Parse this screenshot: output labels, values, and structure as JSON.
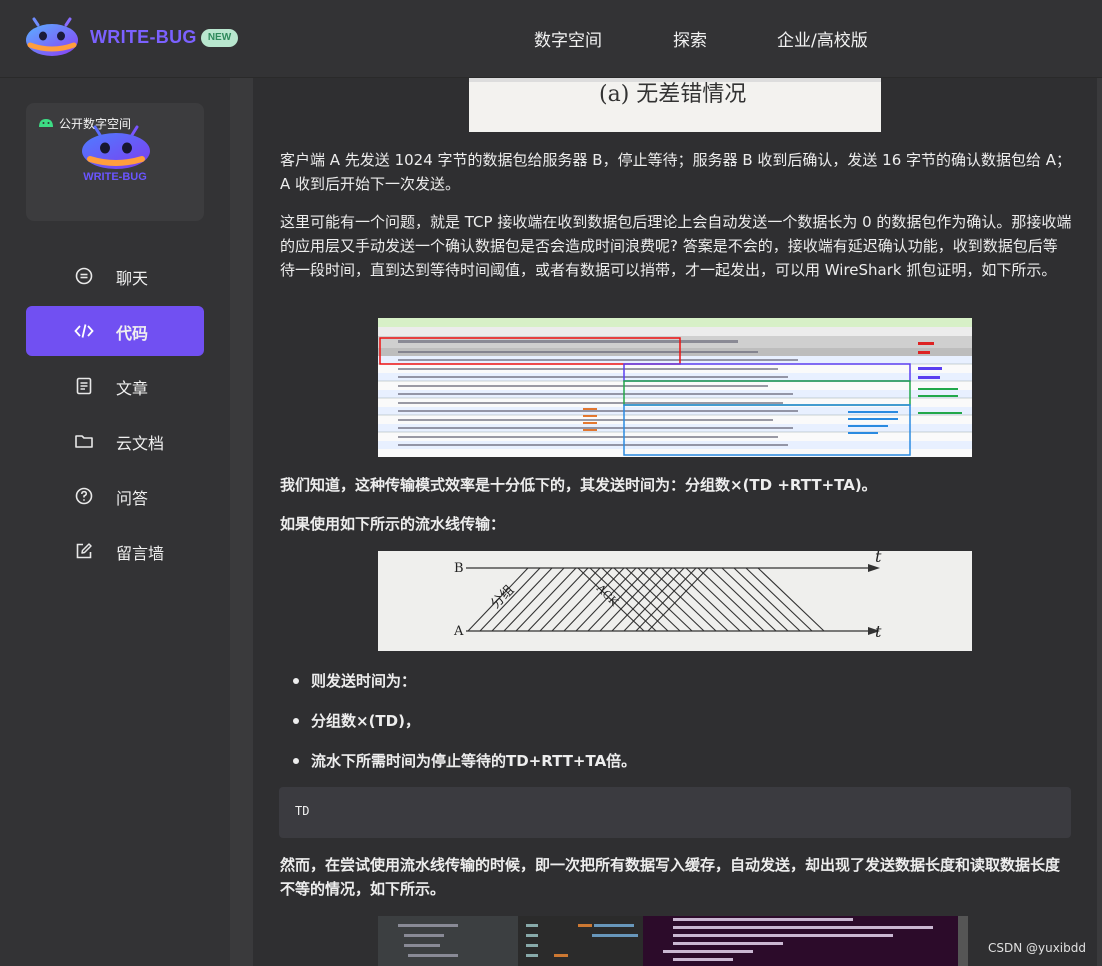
{
  "header": {
    "brand": "WRITE-BUG",
    "badge": "NEW",
    "nav": [
      "数字空间",
      "探索",
      "企业/高校版"
    ]
  },
  "sidebar": {
    "space_label": "公开数字空间",
    "space_brand": "WRITE-BUG",
    "items": [
      {
        "label": "聊天",
        "icon": "chat-icon"
      },
      {
        "label": "代码",
        "icon": "code-icon",
        "active": true
      },
      {
        "label": "文章",
        "icon": "article-icon"
      },
      {
        "label": "云文档",
        "icon": "folder-icon"
      },
      {
        "label": "问答",
        "icon": "question-icon"
      },
      {
        "label": "留言墙",
        "icon": "edit-icon"
      }
    ]
  },
  "article": {
    "fig1_caption": "(a) 无差错情况",
    "p1": "客户端 A 先发送 1024 字节的数据包给服务器 B，停止等待；服务器 B 收到后确认，发送 16 字节的确认数据包给 A；A 收到后开始下一次发送。",
    "p2": "这里可能有一个问题，就是 TCP 接收端在收到数据包后理论上会自动发送一个数据长为 0 的数据包作为确认。那接收端的应用层又手动发送一个确认数据包是否会造成时间浪费呢? 答案是不会的，接收端有延迟确认功能，收到数据包后等待一段时间，直到达到等待时间阈值，或者有数据可以捎带，才一起发出，可以用 WireShark 抓包证明，如下所示。",
    "p3": "我们知道，这种传输模式效率是十分低下的，其发送时间为：分组数×(TD +RTT+TA)。",
    "p4": "如果使用如下所示的流水线传输：",
    "bullets": [
      "则发送时间为：",
      "分组数×(TD)，",
      "流水下所需时间为停止等待的TD+RTT+TA倍。"
    ],
    "code": "TD",
    "p5": "然而，在尝试使用流水线传输的时候，即一次把所有数据写入缓存，自动发送，却出现了发送数据长度和读取数据长度不等的情况，如下所示。",
    "pipeline_labels": {
      "b": "B",
      "a": "A",
      "t": "t",
      "group": "分组",
      "ack": "ACK"
    }
  },
  "watermark": "CSDN @yuxibdd"
}
